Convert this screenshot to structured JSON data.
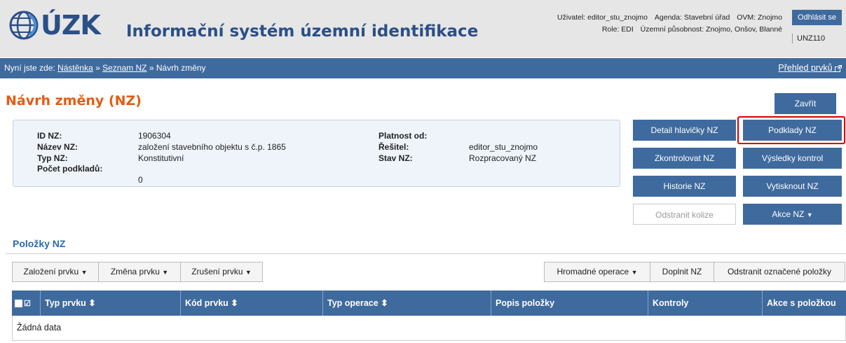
{
  "header": {
    "logo_text": "ÚZK",
    "system_title": "Informační systém územní identifikace",
    "user_label": "Uživatel: editor_stu_znojmo",
    "agenda_label": "Agenda: Stavební úřad",
    "ovm_label": "OVM: Znojmo",
    "role_label": "Role: EDI",
    "scope_label": "Územní působnost: Znojmo, Onšov, Blanné",
    "logout_label": "Odhlásit se",
    "unz_code": "UNZ110"
  },
  "breadcrumb": {
    "prefix": "Nyní jste zde:",
    "items": [
      "Nástěnka",
      "Seznam NZ",
      "Návrh změny"
    ],
    "separator": "»",
    "overview_link": "Přehled prvků"
  },
  "page": {
    "title": "Návrh změny (NZ)"
  },
  "info": {
    "id_label": "ID NZ:",
    "id_value": "1906304",
    "name_label": "Název NZ:",
    "name_value": "založení stavebního objektu s č.p. 1865",
    "type_label": "Typ NZ:",
    "type_value": "Konstitutivní",
    "count_label": "Počet podkladů:",
    "count_value": "0",
    "valid_label": "Platnost od:",
    "valid_value": "",
    "solver_label": "Řešitel:",
    "solver_value": "editor_stu_znojmo",
    "state_label": "Stav NZ:",
    "state_value": "Rozpracovaný NZ"
  },
  "actions": {
    "close": "Zavřít",
    "header_detail": "Detail hlavičky NZ",
    "documents": "Podklady NZ",
    "check": "Zkontrolovat NZ",
    "check_results": "Výsledky kontrol",
    "history": "Historie NZ",
    "print": "Vytisknout NZ",
    "remove_collisions": "Odstranit kolize",
    "actions_menu": "Akce NZ"
  },
  "items_section": {
    "title": "Položky NZ",
    "create": "Založení prvku",
    "change": "Změna prvku",
    "cancel": "Zrušení prvku",
    "bulk": "Hromadné operace",
    "fill": "Doplnit NZ",
    "remove_selected": "Odstranit označené položky"
  },
  "table": {
    "columns": [
      "Typ prvku",
      "Kód prvku",
      "Typ operace",
      "Popis položky",
      "Kontroly",
      "Akce s položkou"
    ],
    "sort_glyph": "⬍",
    "empty": "Žádná data"
  },
  "colors": {
    "primary": "#3f6a9d",
    "title_orange": "#e35c12",
    "highlight_red": "#d80000"
  }
}
